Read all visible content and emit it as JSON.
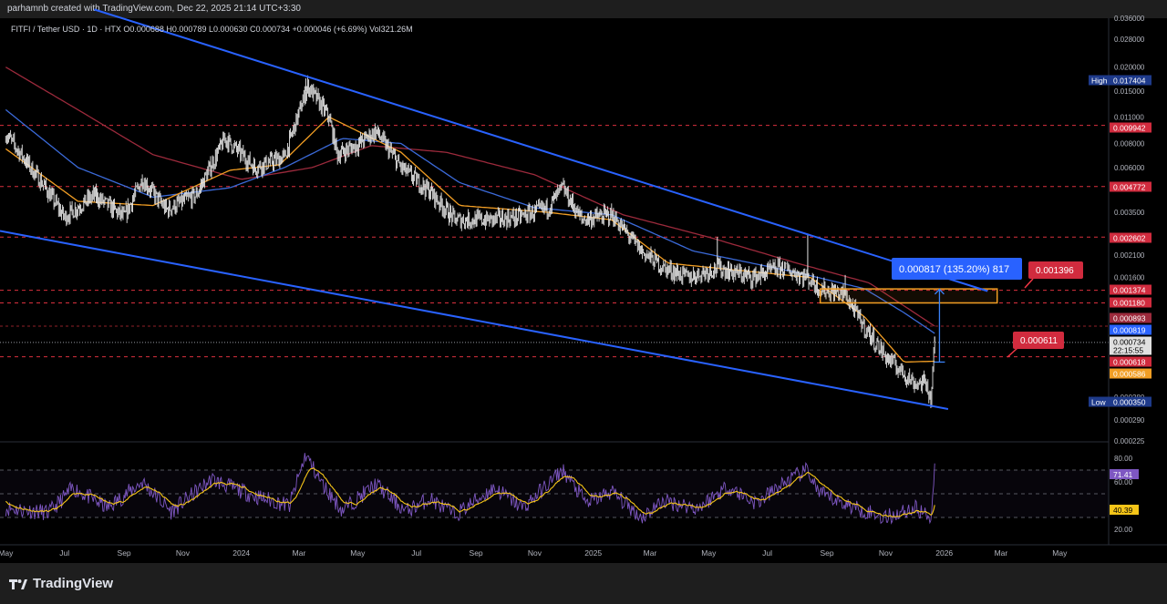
{
  "header": {
    "credit": "parhamnb created with TradingView.com, Dec 22, 2025 21:14 UTC+3:30"
  },
  "legend": {
    "symbol": "FITFI / Tether USD · 1D · HTX",
    "ohlc": "O0.000688 H0.000789 L0.000630 C0.000734 +0.000046 (+6.69%) Vol321.26M"
  },
  "brand": {
    "name": "TradingView"
  },
  "colors": {
    "background": "#000000",
    "price": "#e6e6e6",
    "trendline": "#2962ff",
    "ma_fast": "#f29e24",
    "ma_mid": "#3b6ad9",
    "ma_slow": "#9c2a3c",
    "level": "#f23645",
    "rsi": "#7e57c2",
    "rsi_ma": "#f5c518"
  },
  "chart_data": {
    "type": "line",
    "scale": "log",
    "price_axis_ticks": [
      "0.036000",
      "0.028000",
      "0.020000",
      "0.015000",
      "0.011000",
      "0.008000",
      "0.006000",
      "0.003500",
      "0.002100",
      "0.001600",
      "0.000380",
      "0.000290",
      "0.000225"
    ],
    "time_axis_ticks": [
      "May",
      "Jul",
      "Sep",
      "Nov",
      "2024",
      "Mar",
      "May",
      "Jul",
      "Sep",
      "Nov",
      "2025",
      "Mar",
      "May",
      "Jul",
      "Sep",
      "Nov",
      "2026",
      "Mar",
      "May"
    ],
    "ylim": [
      0.000225,
      0.036
    ],
    "price_labels": [
      {
        "text": "High",
        "value": "0.017404",
        "y": 0.017404,
        "kind": "hilo"
      },
      {
        "text": "",
        "value": "0.009942",
        "y": 0.009942,
        "kind": "level"
      },
      {
        "text": "",
        "value": "0.004772",
        "y": 0.004772,
        "kind": "level"
      },
      {
        "text": "",
        "value": "0.002602",
        "y": 0.002602,
        "kind": "level"
      },
      {
        "text": "",
        "value": "0.001374",
        "y": 0.001374,
        "kind": "level"
      },
      {
        "text": "",
        "value": "0.001180",
        "y": 0.00118,
        "kind": "level"
      },
      {
        "text": "",
        "value": "0.000893",
        "y": 0.000893,
        "kind": "ma_slow"
      },
      {
        "text": "",
        "value": "0.000819",
        "y": 0.000819,
        "kind": "ma_mid"
      },
      {
        "text": "",
        "value": "0.000734",
        "y": 0.000734,
        "kind": "last"
      },
      {
        "text": "",
        "value": "22:15:55",
        "y": 0.000734,
        "kind": "countdown"
      },
      {
        "text": "",
        "value": "0.000618",
        "y": 0.000618,
        "kind": "level"
      },
      {
        "text": "",
        "value": "0.000586",
        "y": 0.000586,
        "kind": "ma_fast"
      },
      {
        "text": "Low",
        "value": "0.000350",
        "y": 0.00035,
        "kind": "hilo"
      }
    ],
    "level_lines": [
      0.009942,
      0.004772,
      0.002602,
      0.001374,
      0.00118,
      0.000618
    ],
    "callouts": {
      "measure": "0.000817 (135.20%) 817",
      "target": "0.001396",
      "support": "0.000611"
    },
    "anchors": [
      {
        "date": "2023-05-01",
        "price": 0.009
      },
      {
        "date": "2023-06-10",
        "price": 0.0048
      },
      {
        "date": "2023-07-01",
        "price": 0.0033
      },
      {
        "date": "2023-08-01",
        "price": 0.0043
      },
      {
        "date": "2023-09-01",
        "price": 0.0033
      },
      {
        "date": "2023-09-20",
        "price": 0.0052
      },
      {
        "date": "2023-10-15",
        "price": 0.0036
      },
      {
        "date": "2023-11-15",
        "price": 0.0043
      },
      {
        "date": "2023-12-15",
        "price": 0.0085
      },
      {
        "date": "2024-01-15",
        "price": 0.006
      },
      {
        "date": "2024-02-15",
        "price": 0.0068
      },
      {
        "date": "2024-03-10",
        "price": 0.016
      },
      {
        "date": "2024-04-01",
        "price": 0.011
      },
      {
        "date": "2024-04-10",
        "price": 0.007
      },
      {
        "date": "2024-05-01",
        "price": 0.0079
      },
      {
        "date": "2024-05-20",
        "price": 0.0093
      },
      {
        "date": "2024-06-15",
        "price": 0.006
      },
      {
        "date": "2024-07-15",
        "price": 0.0045
      },
      {
        "date": "2024-08-10",
        "price": 0.0032
      },
      {
        "date": "2024-09-15",
        "price": 0.0032
      },
      {
        "date": "2024-10-15",
        "price": 0.0033
      },
      {
        "date": "2024-11-15",
        "price": 0.0037
      },
      {
        "date": "2024-11-30",
        "price": 0.0047
      },
      {
        "date": "2024-12-20",
        "price": 0.0032
      },
      {
        "date": "2025-01-20",
        "price": 0.0034
      },
      {
        "date": "2025-02-20",
        "price": 0.0022
      },
      {
        "date": "2025-03-15",
        "price": 0.0018
      },
      {
        "date": "2025-04-10",
        "price": 0.0016
      },
      {
        "date": "2025-05-10",
        "price": 0.0018
      },
      {
        "date": "2025-06-15",
        "price": 0.0016
      },
      {
        "date": "2025-07-15",
        "price": 0.0018
      },
      {
        "date": "2025-08-12",
        "price": 0.0016
      },
      {
        "date": "2025-08-24",
        "price": 0.0014
      },
      {
        "date": "2025-09-20",
        "price": 0.0013
      },
      {
        "date": "2025-10-10",
        "price": 0.00088
      },
      {
        "date": "2025-11-01",
        "price": 0.00062
      },
      {
        "date": "2025-12-01",
        "price": 0.00045
      },
      {
        "date": "2025-12-14",
        "price": 0.00045
      },
      {
        "date": "2025-12-18",
        "price": 0.00036
      },
      {
        "date": "2025-12-22",
        "price": 0.000734
      }
    ],
    "ma_fast": [
      {
        "date": "2023-05-01",
        "price": 0.0075
      },
      {
        "date": "2023-07-15",
        "price": 0.004
      },
      {
        "date": "2023-10-01",
        "price": 0.0038
      },
      {
        "date": "2023-12-20",
        "price": 0.0058
      },
      {
        "date": "2024-02-10",
        "price": 0.0062
      },
      {
        "date": "2024-04-01",
        "price": 0.011
      },
      {
        "date": "2024-06-15",
        "price": 0.0072
      },
      {
        "date": "2024-08-15",
        "price": 0.0038
      },
      {
        "date": "2024-11-15",
        "price": 0.0035
      },
      {
        "date": "2025-01-20",
        "price": 0.0032
      },
      {
        "date": "2025-03-20",
        "price": 0.0019
      },
      {
        "date": "2025-08-15",
        "price": 0.0016
      },
      {
        "date": "2025-10-10",
        "price": 0.001
      },
      {
        "date": "2025-11-20",
        "price": 0.00058
      },
      {
        "date": "2025-12-22",
        "price": 0.000586
      }
    ],
    "ma_mid": [
      {
        "date": "2023-05-01",
        "price": 0.012
      },
      {
        "date": "2023-07-15",
        "price": 0.006
      },
      {
        "date": "2023-10-01",
        "price": 0.0042
      },
      {
        "date": "2023-12-20",
        "price": 0.0047
      },
      {
        "date": "2024-02-15",
        "price": 0.006
      },
      {
        "date": "2024-04-15",
        "price": 0.0085
      },
      {
        "date": "2024-06-15",
        "price": 0.008
      },
      {
        "date": "2024-08-15",
        "price": 0.005
      },
      {
        "date": "2024-11-01",
        "price": 0.0037
      },
      {
        "date": "2025-01-20",
        "price": 0.0034
      },
      {
        "date": "2025-04-15",
        "price": 0.0022
      },
      {
        "date": "2025-08-01",
        "price": 0.0017
      },
      {
        "date": "2025-10-10",
        "price": 0.0014
      },
      {
        "date": "2025-11-20",
        "price": 0.00105
      },
      {
        "date": "2025-12-22",
        "price": 0.000819
      }
    ],
    "ma_slow": [
      {
        "date": "2023-05-01",
        "price": 0.02
      },
      {
        "date": "2023-07-15",
        "price": 0.012
      },
      {
        "date": "2023-10-01",
        "price": 0.007
      },
      {
        "date": "2024-01-01",
        "price": 0.0052
      },
      {
        "date": "2024-03-15",
        "price": 0.006
      },
      {
        "date": "2024-05-15",
        "price": 0.0078
      },
      {
        "date": "2024-08-01",
        "price": 0.0072
      },
      {
        "date": "2024-11-01",
        "price": 0.0055
      },
      {
        "date": "2025-02-01",
        "price": 0.0034
      },
      {
        "date": "2025-05-01",
        "price": 0.0026
      },
      {
        "date": "2025-08-01",
        "price": 0.0019
      },
      {
        "date": "2025-10-15",
        "price": 0.0015
      },
      {
        "date": "2025-12-22",
        "price": 0.000893
      }
    ],
    "trendlines": [
      {
        "from": {
          "date": "2023-08-01",
          "price": 0.04
        },
        "to": {
          "date": "2026-02-15",
          "price": 0.00136
        }
      },
      {
        "from": {
          "date": "2023-04-25",
          "price": 0.0028
        },
        "to": {
          "date": "2026-01-05",
          "price": 0.00033
        }
      }
    ],
    "zone": {
      "from": "2025-08-25",
      "to": "2026-02-25",
      "top": 0.001396,
      "bottom": 0.00118
    },
    "rsi": {
      "ticks": [
        "80.00",
        "60.00",
        "20.00"
      ],
      "ylim": [
        10,
        90
      ],
      "value": "71.41",
      "ma_value": "40.39",
      "bands": [
        70,
        50,
        30
      ],
      "anchors": [
        {
          "date": "2023-05-01",
          "v": 38
        },
        {
          "date": "2023-06-15",
          "v": 34
        },
        {
          "date": "2023-07-10",
          "v": 55
        },
        {
          "date": "2023-08-15",
          "v": 38
        },
        {
          "date": "2023-09-20",
          "v": 60
        },
        {
          "date": "2023-10-20",
          "v": 35
        },
        {
          "date": "2023-12-01",
          "v": 62
        },
        {
          "date": "2024-01-15",
          "v": 48
        },
        {
          "date": "2024-02-20",
          "v": 40
        },
        {
          "date": "2024-03-08",
          "v": 83
        },
        {
          "date": "2024-03-25",
          "v": 58
        },
        {
          "date": "2024-04-15",
          "v": 36
        },
        {
          "date": "2024-05-20",
          "v": 58
        },
        {
          "date": "2024-06-20",
          "v": 35
        },
        {
          "date": "2024-07-15",
          "v": 46
        },
        {
          "date": "2024-08-10",
          "v": 32
        },
        {
          "date": "2024-09-20",
          "v": 55
        },
        {
          "date": "2024-10-20",
          "v": 38
        },
        {
          "date": "2024-11-30",
          "v": 70
        },
        {
          "date": "2024-12-25",
          "v": 42
        },
        {
          "date": "2025-01-20",
          "v": 52
        },
        {
          "date": "2025-02-20",
          "v": 30
        },
        {
          "date": "2025-03-15",
          "v": 44
        },
        {
          "date": "2025-04-20",
          "v": 38
        },
        {
          "date": "2025-05-20",
          "v": 56
        },
        {
          "date": "2025-06-20",
          "v": 42
        },
        {
          "date": "2025-07-20",
          "v": 60
        },
        {
          "date": "2025-08-12",
          "v": 70
        },
        {
          "date": "2025-08-24",
          "v": 50
        },
        {
          "date": "2025-10-01",
          "v": 38
        },
        {
          "date": "2025-11-01",
          "v": 30
        },
        {
          "date": "2025-12-01",
          "v": 38
        },
        {
          "date": "2025-12-18",
          "v": 30
        },
        {
          "date": "2025-12-22",
          "v": 71.41
        }
      ]
    }
  }
}
